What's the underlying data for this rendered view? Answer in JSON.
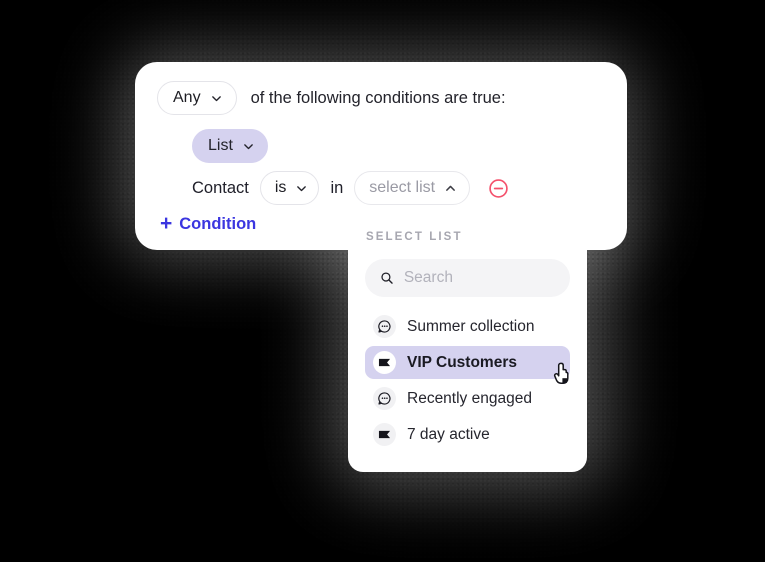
{
  "condition_card": {
    "match_select": {
      "value": "Any",
      "icon": "chevron-down-icon"
    },
    "intro_text": "of the following conditions are true:",
    "type_chip": {
      "value": "List",
      "icon": "chevron-down-icon"
    },
    "subject_label": "Contact",
    "operator_select": {
      "value": "is",
      "icon": "chevron-down-icon"
    },
    "joiner_label": "in",
    "value_select": {
      "placeholder": "select list",
      "icon": "chevron-up-icon"
    },
    "remove_icon": "remove-circle-icon",
    "add_condition": {
      "plus": "+",
      "label": "Condition"
    }
  },
  "dropdown": {
    "title": "SELECT LIST",
    "search": {
      "value": "",
      "placeholder": "Search",
      "icon": "search-icon"
    },
    "items": [
      {
        "label": "Summer collection",
        "icon": "chat-bubble-icon",
        "selected": false
      },
      {
        "label": "VIP Customers",
        "icon": "ticket-icon",
        "selected": true
      },
      {
        "label": "Recently engaged",
        "icon": "chat-bubble-icon",
        "selected": false
      },
      {
        "label": "7 day active",
        "icon": "ticket-icon",
        "selected": false
      }
    ],
    "cursor_icon": "pointing-hand-cursor"
  },
  "colors": {
    "background": "#000000",
    "card": "#ffffff",
    "accent_lavender": "#d5d2ef",
    "accent_blue": "#3b36e0",
    "danger_red": "#f4516c",
    "muted_text": "#a7a7b0"
  }
}
